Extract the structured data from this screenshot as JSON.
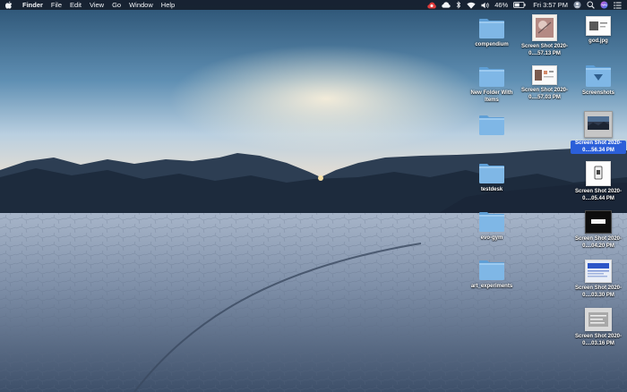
{
  "menubar": {
    "app_name": "Finder",
    "menus": [
      "File",
      "Edit",
      "View",
      "Go",
      "Window",
      "Help"
    ],
    "battery_percent": "46%",
    "clock": "Fri 3:57 PM",
    "status_icons": [
      "creative-cloud-icon",
      "cloud-icon",
      "bluetooth-icon",
      "wifi-icon",
      "volume-icon",
      "battery-icon",
      "user-avatar-icon",
      "spotlight-icon",
      "siri-icon",
      "notification-center-icon"
    ]
  },
  "desktop": {
    "folders": [
      {
        "label": "compendium"
      },
      {
        "label": "New Folder With Items"
      },
      {
        "label": ""
      },
      {
        "label": "testdesk"
      },
      {
        "label": "evo-gym"
      },
      {
        "label": "art_experiments"
      }
    ],
    "column2": [
      {
        "label": "Screen Shot 2020-0....57.13 PM"
      },
      {
        "label": "Screen Shot 2020-0....57.03 PM"
      }
    ],
    "column3": [
      {
        "label": "god.jpg"
      },
      {
        "label": "Screenshots"
      },
      {
        "label": "Screen Shot 2020-0....56.34 PM",
        "selected": true
      },
      {
        "label": "Screen Shot 2020-0....05.44 PM"
      },
      {
        "label": "Screen Shot 2020-0....04.20 PM"
      },
      {
        "label": "Screen Shot 2020-0....03.30 PM"
      },
      {
        "label": "Screen Shot 2020-0....03.16 PM"
      }
    ]
  },
  "colors": {
    "menubar_bg": "#161e2c",
    "folder_blue": "#7fb7e6",
    "selection_blue": "#2b5fd9",
    "sky_top": "#2e5577",
    "horizon_glow": "#f2d6b0",
    "ground": "#8f9eb3"
  }
}
